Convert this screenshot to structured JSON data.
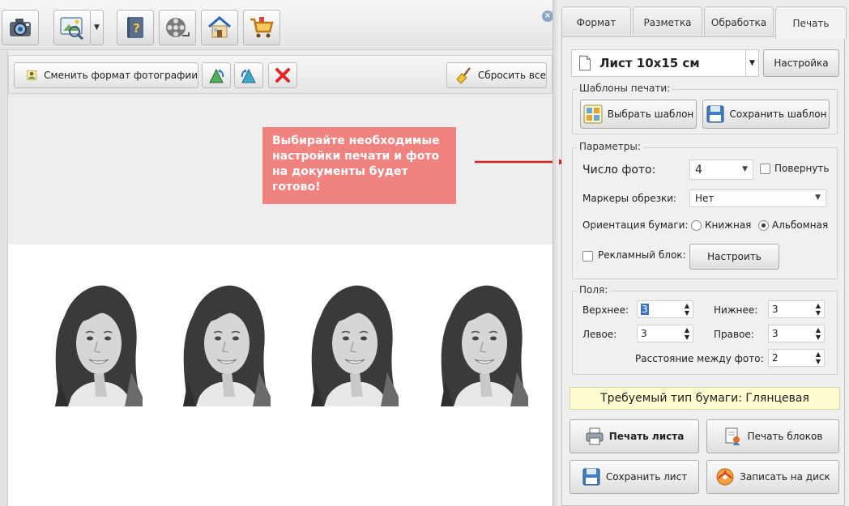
{
  "toolbar": {
    "buttons": [
      {
        "name": "camera-button",
        "icon": "camera-icon"
      },
      {
        "name": "photo-editor-button",
        "icon": "photo-editor-icon"
      },
      {
        "name": "help-book-button",
        "icon": "help-book-icon"
      },
      {
        "name": "video-button",
        "icon": "film-reel-icon"
      },
      {
        "name": "home-button",
        "icon": "house-icon"
      },
      {
        "name": "shop-button",
        "icon": "cart-icon"
      }
    ],
    "close_glyph": "×"
  },
  "subtoolbar": {
    "change_format_label": "Сменить формат фотографии",
    "reset_all_label": "Сбросить все"
  },
  "callout": {
    "text": "Выбирайте необходимые настройки печати и фото на документы будет готово!"
  },
  "tabs": [
    {
      "label": "Формат",
      "active": false
    },
    {
      "label": "Разметка",
      "active": false
    },
    {
      "label": "Обработка",
      "active": false
    },
    {
      "label": "Печать",
      "active": true
    }
  ],
  "sheet": {
    "selected": "Лист 10x15 см",
    "settings_label": "Настройка"
  },
  "templates": {
    "title": "Шаблоны печати:",
    "choose_label": "Выбрать шаблон",
    "save_label": "Сохранить шаблон"
  },
  "params": {
    "title": "Параметры:",
    "photo_count_label": "Число фото:",
    "photo_count_value": "4",
    "rotate_label": "Повернуть",
    "crop_markers_label": "Маркеры обрезки:",
    "crop_markers_value": "Нет",
    "orientation_label": "Ориентация бумаги:",
    "portrait_label": "Книжная",
    "landscape_label": "Альбомная",
    "orientation_selected": "landscape",
    "ad_block_label": "Рекламный блок:",
    "configure_label": "Настроить"
  },
  "margins": {
    "title": "Поля:",
    "top_label": "Верхнее:",
    "top_value": "3",
    "bottom_label": "Нижнее:",
    "bottom_value": "3",
    "left_label": "Левое:",
    "left_value": "3",
    "right_label": "Правое:",
    "right_value": "3",
    "spacing_label": "Расстояние между фото:",
    "spacing_value": "2"
  },
  "paper_note": "Требуемый тип бумаги: Глянцевая",
  "actions": {
    "print_sheet": "Печать листа",
    "print_blocks": "Печать блоков",
    "save_sheet": "Сохранить лист",
    "burn_disc": "Записать на диск"
  },
  "colors": {
    "callout_bg": "#f08280",
    "arrow": "#d42020",
    "paper_note_bg": "#fbfbcf",
    "selection": "#3b74c6"
  }
}
